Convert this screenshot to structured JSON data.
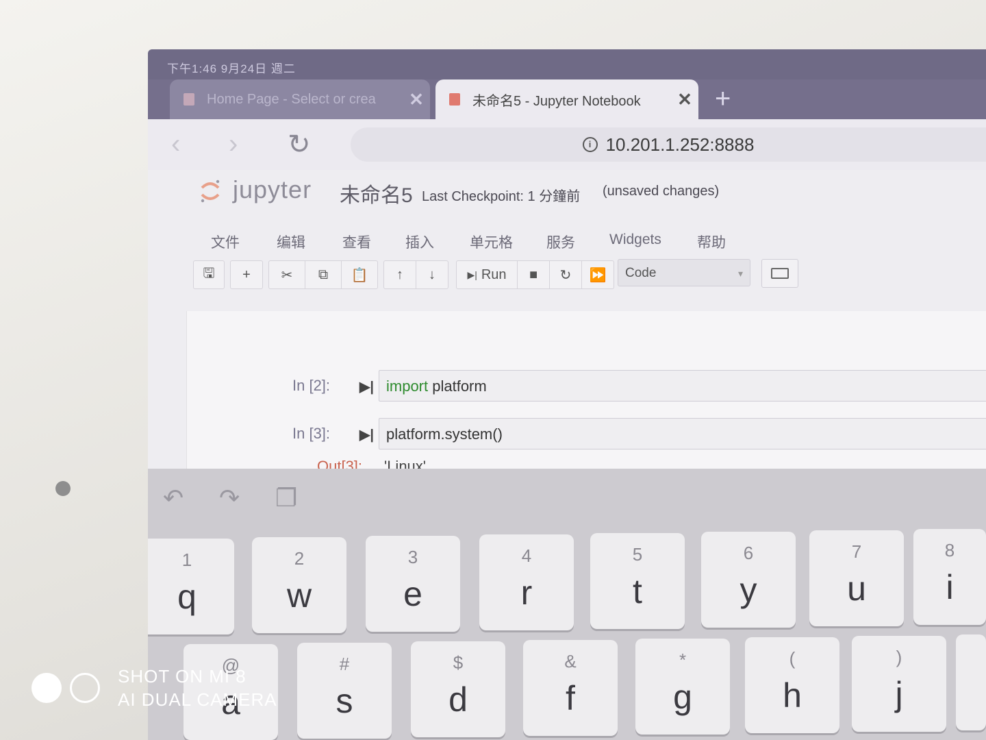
{
  "status_bar": {
    "text": "下午1:46 9月24日 週二"
  },
  "tabs": [
    {
      "label": "Home Page - Select or crea",
      "close": "✕"
    },
    {
      "label": "未命名5 - Jupyter Notebook",
      "close": "✕"
    }
  ],
  "new_tab": "+",
  "nav": {
    "back": "‹",
    "forward": "›",
    "reload": "↻",
    "info_icon": "i",
    "url": "10.201.1.252:8888"
  },
  "jupyter": {
    "logo_text": "jupyter",
    "notebook_name": "未命名5",
    "checkpoint": "Last Checkpoint: 1 分鐘前",
    "unsaved": "(unsaved changes)"
  },
  "menu": [
    "文件",
    "编辑",
    "查看",
    "插入",
    "单元格",
    "服务",
    "Widgets",
    "帮助"
  ],
  "toolbar": {
    "save": "🖫",
    "add": "+",
    "cut": "✂",
    "copy": "⧉",
    "paste": "📋",
    "up": "↑",
    "down": "↓",
    "run_label": "Run",
    "run_icon": "▶|",
    "stop": "■",
    "restart": "↻",
    "fast_forward": "⏩",
    "cell_type": "Code",
    "cell_type_caret": "▾"
  },
  "cells": [
    {
      "prompt": "In [2]:",
      "run": "▶|",
      "code_kw": "import",
      "code_rest": " platform"
    },
    {
      "prompt": "In [3]:",
      "run": "▶|",
      "code_kw": "",
      "code_rest": "platform.system()"
    }
  ],
  "output": {
    "prompt": "Out[3]:",
    "text": "'Linux'"
  },
  "keyboard_tools": {
    "undo": "↶",
    "redo": "↷",
    "clipboard": "❐"
  },
  "keys_row1": [
    {
      "sub": "1",
      "main": "q"
    },
    {
      "sub": "2",
      "main": "w"
    },
    {
      "sub": "3",
      "main": "e"
    },
    {
      "sub": "4",
      "main": "r"
    },
    {
      "sub": "5",
      "main": "t"
    },
    {
      "sub": "6",
      "main": "y"
    },
    {
      "sub": "7",
      "main": "u"
    },
    {
      "sub": "8",
      "main": "i"
    }
  ],
  "keys_row2": [
    {
      "sub": "@",
      "main": "a"
    },
    {
      "sub": "#",
      "main": "s"
    },
    {
      "sub": "$",
      "main": "d"
    },
    {
      "sub": "&",
      "main": "f"
    },
    {
      "sub": "*",
      "main": "g"
    },
    {
      "sub": "(",
      "main": "h"
    },
    {
      "sub": ")",
      "main": "j"
    },
    {
      "sub": "",
      "main": ""
    }
  ],
  "watermark": {
    "line1": "SHOT ON MI 8",
    "line2": "AI DUAL CAMERA"
  }
}
